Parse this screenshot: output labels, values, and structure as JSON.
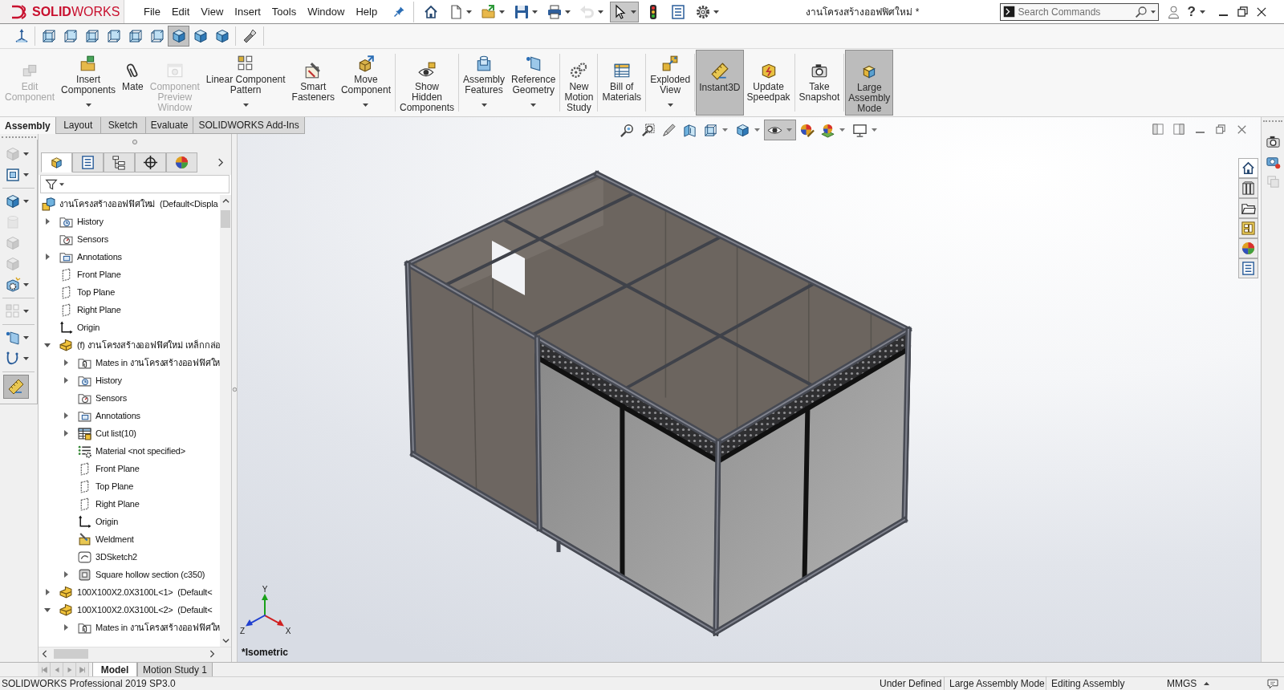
{
  "window": {
    "title": "งานโครงสร้างออฟฟิศใหม่ *"
  },
  "logo": {
    "text": "**SOLID**WORKS"
  },
  "menu": [
    "File",
    "Edit",
    "View",
    "Insert",
    "Tools",
    "Window",
    "Help"
  ],
  "quick_access": [
    {
      "dropdown": false,
      "disabled": false,
      "selected": false
    },
    {
      "dropdown": true,
      "disabled": false,
      "selected": false
    },
    {
      "dropdown": true,
      "disabled": false,
      "selected": false
    },
    {
      "dropdown": true,
      "disabled": false,
      "selected": false
    },
    {
      "dropdown": true,
      "disabled": false,
      "selected": false
    },
    {
      "dropdown": true,
      "disabled": true,
      "selected": false
    },
    {
      "dropdown": true,
      "disabled": false,
      "selected": true
    },
    {
      "dropdown": false,
      "disabled": false,
      "selected": false
    },
    {
      "dropdown": false,
      "disabled": false,
      "selected": false
    },
    {
      "dropdown": true,
      "disabled": false,
      "selected": false
    }
  ],
  "search": {
    "placeholder": "Search Commands"
  },
  "help_button": {
    "label": "?",
    "dropdown": true
  },
  "view_toolbar": [
    [
      {
        "selected": false
      }
    ],
    [
      {
        "selected": false
      },
      {
        "selected": false
      },
      {
        "selected": false
      },
      {
        "selected": false
      },
      {
        "selected": false
      },
      {
        "selected": false
      },
      {
        "selected": true
      },
      {
        "selected": false
      },
      {
        "selected": false
      }
    ],
    [
      {
        "selected": false
      }
    ]
  ],
  "command_manager": {
    "groups": [
      [
        {
          "label": "Edit\nComponent",
          "dropdown": false,
          "disabled": true,
          "selected": false
        },
        {
          "label": "Insert\nComponents",
          "dropdown": true,
          "disabled": false,
          "selected": false
        },
        {
          "label": "Mate",
          "dropdown": false,
          "disabled": false,
          "selected": false
        },
        {
          "label": "Component\nPreview\nWindow",
          "dropdown": false,
          "disabled": true,
          "selected": false
        },
        {
          "label": "Linear Component\nPattern",
          "dropdown": true,
          "disabled": false,
          "selected": false
        },
        {
          "label": "Smart\nFasteners",
          "dropdown": false,
          "disabled": false,
          "selected": false
        },
        {
          "label": "Move\nComponent",
          "dropdown": true,
          "disabled": false,
          "selected": false
        }
      ],
      [
        {
          "label": "Show\nHidden\nComponents",
          "dropdown": false,
          "disabled": false,
          "selected": false
        }
      ],
      [
        {
          "label": "Assembly\nFeatures",
          "dropdown": true,
          "disabled": false,
          "selected": false
        },
        {
          "label": "Reference\nGeometry",
          "dropdown": true,
          "disabled": false,
          "selected": false
        }
      ],
      [
        {
          "label": "New\nMotion\nStudy",
          "dropdown": false,
          "disabled": false,
          "selected": false
        }
      ],
      [
        {
          "label": "Bill of\nMaterials",
          "dropdown": false,
          "disabled": false,
          "selected": false
        }
      ],
      [
        {
          "label": "Exploded\nView",
          "dropdown": true,
          "disabled": false,
          "selected": false
        }
      ],
      [
        {
          "label": "Instant3D",
          "dropdown": false,
          "disabled": false,
          "selected": true
        },
        {
          "label": "Update\nSpeedpak",
          "dropdown": false,
          "disabled": false,
          "selected": false
        }
      ],
      [
        {
          "label": "Take\nSnapshot",
          "dropdown": false,
          "disabled": false,
          "selected": false
        }
      ],
      [
        {
          "label": "Large\nAssembly\nMode",
          "dropdown": false,
          "disabled": false,
          "selected": true
        }
      ]
    ]
  },
  "command_tabs": [
    {
      "label": "Assembly",
      "selected": true
    },
    {
      "label": "Layout",
      "selected": false
    },
    {
      "label": "Sketch",
      "selected": false
    },
    {
      "label": "Evaluate",
      "selected": false
    },
    {
      "label": "SOLIDWORKS Add-Ins",
      "selected": false
    }
  ],
  "left_toolbar": [
    [
      {
        "dropdown": true,
        "disabled": true,
        "selected": false
      },
      {
        "dropdown": true,
        "disabled": false,
        "selected": false
      }
    ],
    [
      {
        "dropdown": true,
        "disabled": false,
        "selected": false
      },
      {
        "dropdown": false,
        "disabled": true,
        "selected": false
      },
      {
        "dropdown": false,
        "disabled": true,
        "selected": false
      },
      {
        "dropdown": false,
        "disabled": true,
        "selected": false
      },
      {
        "dropdown": true,
        "disabled": false,
        "selected": false
      }
    ],
    [
      {
        "dropdown": true,
        "disabled": true,
        "selected": false
      }
    ],
    [
      {
        "dropdown": true,
        "disabled": false,
        "selected": false
      },
      {
        "dropdown": true,
        "disabled": false,
        "selected": false
      }
    ],
    [
      {
        "dropdown": false,
        "disabled": false,
        "selected": true
      }
    ]
  ],
  "feature_manager": {
    "tabs": [
      {
        "selected": true
      },
      {
        "selected": false
      },
      {
        "selected": false
      },
      {
        "selected": false
      },
      {
        "selected": false
      }
    ],
    "tree": [
      {
        "kind": "assembly",
        "label": "งานโครงสร้างออฟฟิศใหม่  (Default<Displa",
        "children": [
          {
            "kind": "history",
            "label": "History",
            "expanded": false
          },
          {
            "kind": "sensors",
            "label": "Sensors"
          },
          {
            "kind": "annotations",
            "label": "Annotations",
            "expanded": false
          },
          {
            "kind": "plane",
            "label": "Front Plane"
          },
          {
            "kind": "plane",
            "label": "Top Plane"
          },
          {
            "kind": "plane",
            "label": "Right Plane"
          },
          {
            "kind": "origin",
            "label": "Origin"
          },
          {
            "kind": "part",
            "label": "(f) งานโครงสร้างออฟฟิศใหม่ เหล็กกล่อ",
            "expanded": true,
            "children": [
              {
                "kind": "mates",
                "label": "Mates in งานโครงสร้างออฟฟิศให",
                "expanded": false
              },
              {
                "kind": "history",
                "label": "History",
                "expanded": false
              },
              {
                "kind": "sensors",
                "label": "Sensors"
              },
              {
                "kind": "annotations",
                "label": "Annotations",
                "expanded": false
              },
              {
                "kind": "cutlist",
                "label": "Cut list(10)",
                "expanded": false
              },
              {
                "kind": "material",
                "label": "Material <not specified>"
              },
              {
                "kind": "plane",
                "label": "Front Plane"
              },
              {
                "kind": "plane",
                "label": "Top Plane"
              },
              {
                "kind": "plane",
                "label": "Right Plane"
              },
              {
                "kind": "origin",
                "label": "Origin"
              },
              {
                "kind": "weldment",
                "label": "Weldment"
              },
              {
                "kind": "sketch3d",
                "label": "3DSketch2"
              },
              {
                "kind": "profile",
                "label": "Square hollow section (c350)",
                "expanded": false
              }
            ]
          },
          {
            "kind": "part",
            "label": "100X100X2.0X3100L<1>  (Default<",
            "expanded": false
          },
          {
            "kind": "part",
            "label": "100X100X2.0X3100L<2>  (Default<",
            "expanded": true,
            "children": [
              {
                "kind": "mates",
                "label": "Mates in งานโครงสร้างออฟฟิศให",
                "expanded": false
              }
            ]
          }
        ]
      }
    ]
  },
  "heads_up_toolbar": [
    {
      "dropdown": false,
      "selected": false
    },
    {
      "dropdown": false,
      "selected": false
    },
    {
      "dropdown": false,
      "selected": false
    },
    {
      "dropdown": false,
      "selected": false
    },
    {
      "dropdown": true,
      "selected": false
    },
    {
      "dropdown": true,
      "selected": false
    },
    {
      "dropdown": true,
      "selected": true
    },
    {
      "dropdown": false,
      "selected": false
    },
    {
      "dropdown": true,
      "selected": false
    },
    {
      "dropdown": true,
      "selected": false
    }
  ],
  "task_pane_tabs": [
    {
      "selected": true
    },
    {
      "selected": false
    },
    {
      "selected": false
    },
    {
      "selected": false
    },
    {
      "selected": false
    },
    {
      "selected": false
    }
  ],
  "viewport": {
    "view_name": "*Isometric",
    "axes": {
      "x": "X",
      "y": "Y",
      "z": "Z"
    }
  },
  "bottom_tabs": [
    {
      "label": "Model",
      "selected": true
    },
    {
      "label": "Motion Study 1",
      "selected": false
    }
  ],
  "status_bar": {
    "product": "SOLIDWORKS Professional 2019 SP3.0",
    "fields": [
      "Under Defined",
      "Large Assembly Mode",
      "Editing Assembly",
      "MMGS"
    ]
  }
}
